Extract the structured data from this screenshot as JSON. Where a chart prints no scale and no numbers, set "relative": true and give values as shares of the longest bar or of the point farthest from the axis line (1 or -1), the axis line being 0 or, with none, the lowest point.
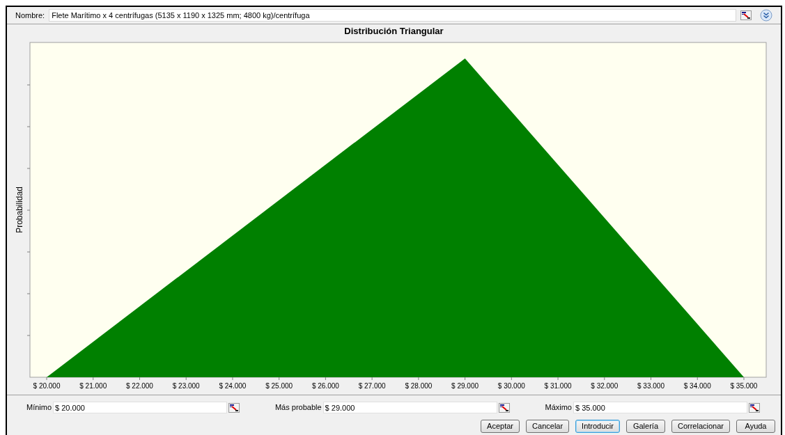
{
  "name_field": {
    "label": "Nombre:",
    "value": "Flete Marítimo x 4 centrífugas (5135 x 1190 x 1325 mm; 4800 kg)/centrífuga"
  },
  "chart": {
    "chart_data": {
      "type": "area",
      "title": "Distribución Triangular",
      "ylabel": "Probabilidad",
      "x": [
        20000,
        29000,
        35000
      ],
      "relative": true,
      "series": [
        {
          "color": "#008000",
          "values": [
            0,
            1,
            0
          ]
        }
      ],
      "xlim": [
        19640,
        35480
      ],
      "xticks": [
        {
          "value": 20000,
          "label": "$ 20.000"
        },
        {
          "value": 21000,
          "label": "$ 21.000"
        },
        {
          "value": 22000,
          "label": "$ 22.000"
        },
        {
          "value": 23000,
          "label": "$ 23.000"
        },
        {
          "value": 24000,
          "label": "$ 24.000"
        },
        {
          "value": 25000,
          "label": "$ 25.000"
        },
        {
          "value": 26000,
          "label": "$ 26.000"
        },
        {
          "value": 27000,
          "label": "$ 27.000"
        },
        {
          "value": 28000,
          "label": "$ 28.000"
        },
        {
          "value": 29000,
          "label": "$ 29.000"
        },
        {
          "value": 30000,
          "label": "$ 30.000"
        },
        {
          "value": 31000,
          "label": "$ 31.000"
        },
        {
          "value": 32000,
          "label": "$ 32.000"
        },
        {
          "value": 33000,
          "label": "$ 33.000"
        },
        {
          "value": 34000,
          "label": "$ 34.000"
        },
        {
          "value": 35000,
          "label": "$ 35.000"
        }
      ]
    }
  },
  "parameters": [
    {
      "label": "Mínimo",
      "value": "$ 20.000"
    },
    {
      "label": "Más probable",
      "value": "$ 29.000"
    },
    {
      "label": "Máximo",
      "value": "$ 35.000"
    }
  ],
  "buttons": [
    {
      "label": "Aceptar",
      "selected": false
    },
    {
      "label": "Cancelar",
      "selected": false
    },
    {
      "label": "Introducir",
      "selected": true
    },
    {
      "label": "Galería",
      "selected": false
    },
    {
      "label": "Correlacionar",
      "selected": false
    },
    {
      "label": "Ayuda",
      "selected": false
    }
  ]
}
